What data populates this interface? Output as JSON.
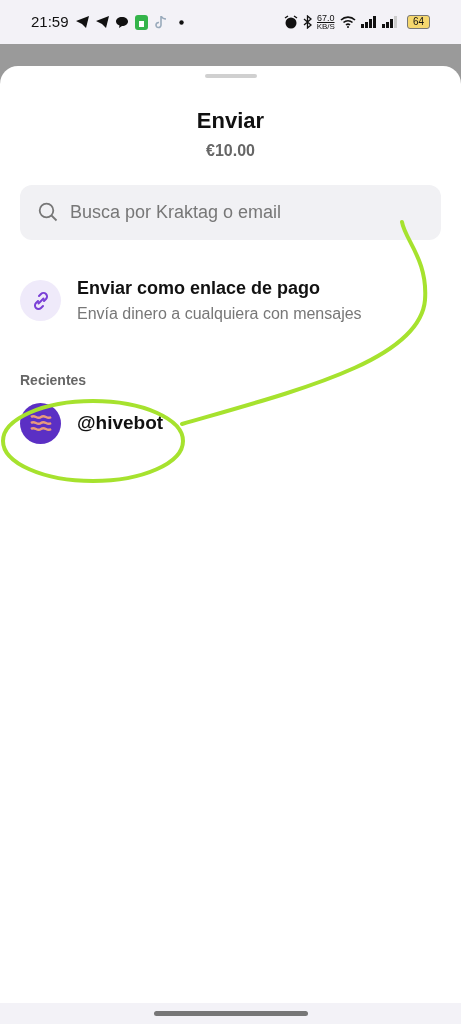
{
  "status_bar": {
    "time": "21:59",
    "speed": "67.0",
    "speed_unit": "KB/S",
    "battery": "64"
  },
  "sheet": {
    "title": "Enviar",
    "amount": "€10.00"
  },
  "search": {
    "placeholder": "Busca por Kraktag o email"
  },
  "payment_link": {
    "title": "Enviar como enlace de pago",
    "subtitle": "Envía dinero a cualquiera con mensajes"
  },
  "recents": {
    "heading": "Recientes",
    "items": [
      {
        "handle": "@hivebot"
      }
    ]
  }
}
